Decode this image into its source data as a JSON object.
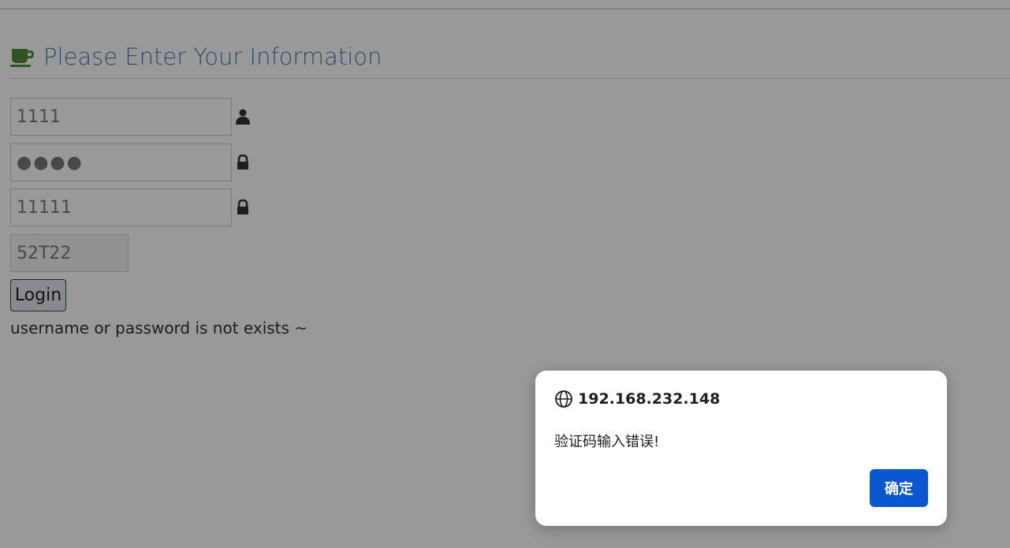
{
  "page": {
    "heading": "Please Enter Your Information",
    "heading_icon": "coffee-cup-icon",
    "colors": {
      "heading": "#4d7fb5",
      "cup_icon": "#4f8a3a",
      "dialog_button": "#0b57d0"
    }
  },
  "form": {
    "username_value": "1111",
    "username_icon": "user-icon",
    "password_value": "●●●●",
    "password_icon": "lock-icon",
    "confirm_value": "11111",
    "confirm_icon": "lock-icon",
    "captcha_value": "52T22",
    "login_label": "Login",
    "error_message": "username or password is not exists ~"
  },
  "dialog": {
    "origin_icon": "globe-icon",
    "origin": "192.168.232.148",
    "message": "验证码输入错误!",
    "ok_label": "确定"
  }
}
